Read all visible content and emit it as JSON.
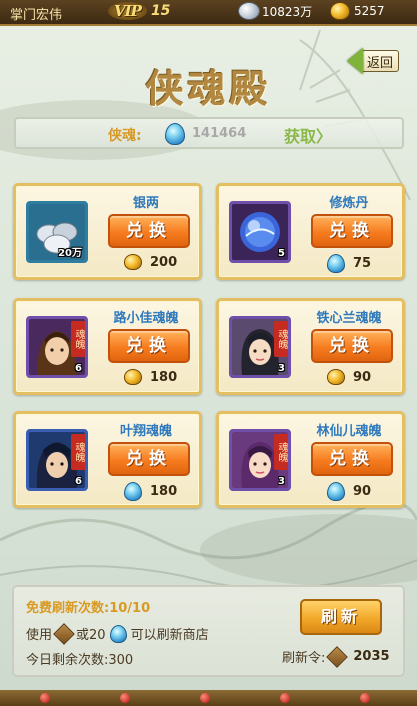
{
  "topbar": {
    "player_name": "掌门宏伟",
    "vip_label": "VIP",
    "vip_level": "15",
    "silver": "10823万",
    "gold": "5257"
  },
  "header": {
    "title": "侠魂殿",
    "back_label": "返回"
  },
  "soul_bar": {
    "label": "侠魂:",
    "value": "141464",
    "get_label": "获取〉"
  },
  "items": [
    {
      "name": "银两",
      "count": "20万",
      "button": "兑换",
      "price": "200",
      "currency": "gold",
      "soul": false,
      "thumb": "silver-ingots"
    },
    {
      "name": "修炼丹",
      "count": "5",
      "button": "兑换",
      "price": "75",
      "currency": "soul",
      "soul": false,
      "thumb": "blue-orb"
    },
    {
      "name": "路小佳魂魄",
      "count": "6",
      "button": "兑换",
      "price": "180",
      "currency": "gold",
      "soul": true,
      "tag": "魂魄"
    },
    {
      "name": "铁心兰魂魄",
      "count": "3",
      "button": "兑换",
      "price": "90",
      "currency": "gold",
      "soul": true,
      "tag": "魂魄"
    },
    {
      "name": "叶翔魂魄",
      "count": "6",
      "button": "兑换",
      "price": "180",
      "currency": "soul",
      "soul": true,
      "tag": "魂魄"
    },
    {
      "name": "林仙儿魂魄",
      "count": "3",
      "button": "兑换",
      "price": "90",
      "currency": "soul",
      "soul": true,
      "tag": "魂魄"
    }
  ],
  "refresh": {
    "free_label": "免费刷新次数:10/10",
    "use_prefix": "使用",
    "use_middle": "或20",
    "use_suffix": "可以刷新商店",
    "remain_label": "今日剩余次数:300",
    "button": "刷新",
    "token_label": "刷新令:",
    "token_value": "2035"
  },
  "colors": {
    "title": "#b28840",
    "item_name": "#2f79bc",
    "button_orange": "#f77c1f",
    "accent_gold": "#d79a28",
    "get_green": "#8ab94a"
  }
}
